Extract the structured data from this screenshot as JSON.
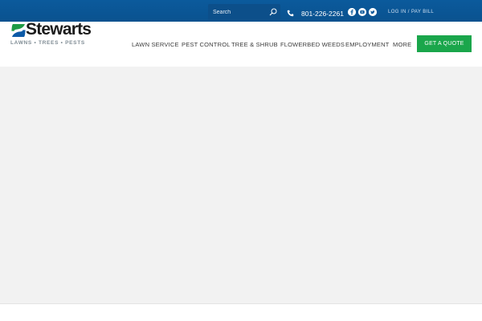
{
  "topbar": {
    "search_placeholder": "Search",
    "phone": "801-226-2261",
    "login_label": "LOG IN / PAY BILL",
    "social_icons": [
      "facebook-icon",
      "youtube-icon",
      "twitter-icon"
    ]
  },
  "logo": {
    "name": "Stewarts",
    "tagline": "LAWNS • TREES • PESTS"
  },
  "nav": {
    "items": [
      {
        "label": "LAWN SERVICE"
      },
      {
        "label": "PEST CONTROL"
      },
      {
        "label": "TREE & SHRUB"
      },
      {
        "label": "FLOWERBED WEEDS"
      },
      {
        "label": "EMPLOYMENT"
      },
      {
        "label": "MORE"
      }
    ],
    "cta_label": "GET A QUOTE"
  },
  "colors": {
    "topbar_blue": "#0b5a9c",
    "cta_green": "#1aa64b",
    "logo_green": "#1e9b44",
    "logo_blue": "#0d5aa7",
    "hero_gray": "#f2f2f2"
  }
}
